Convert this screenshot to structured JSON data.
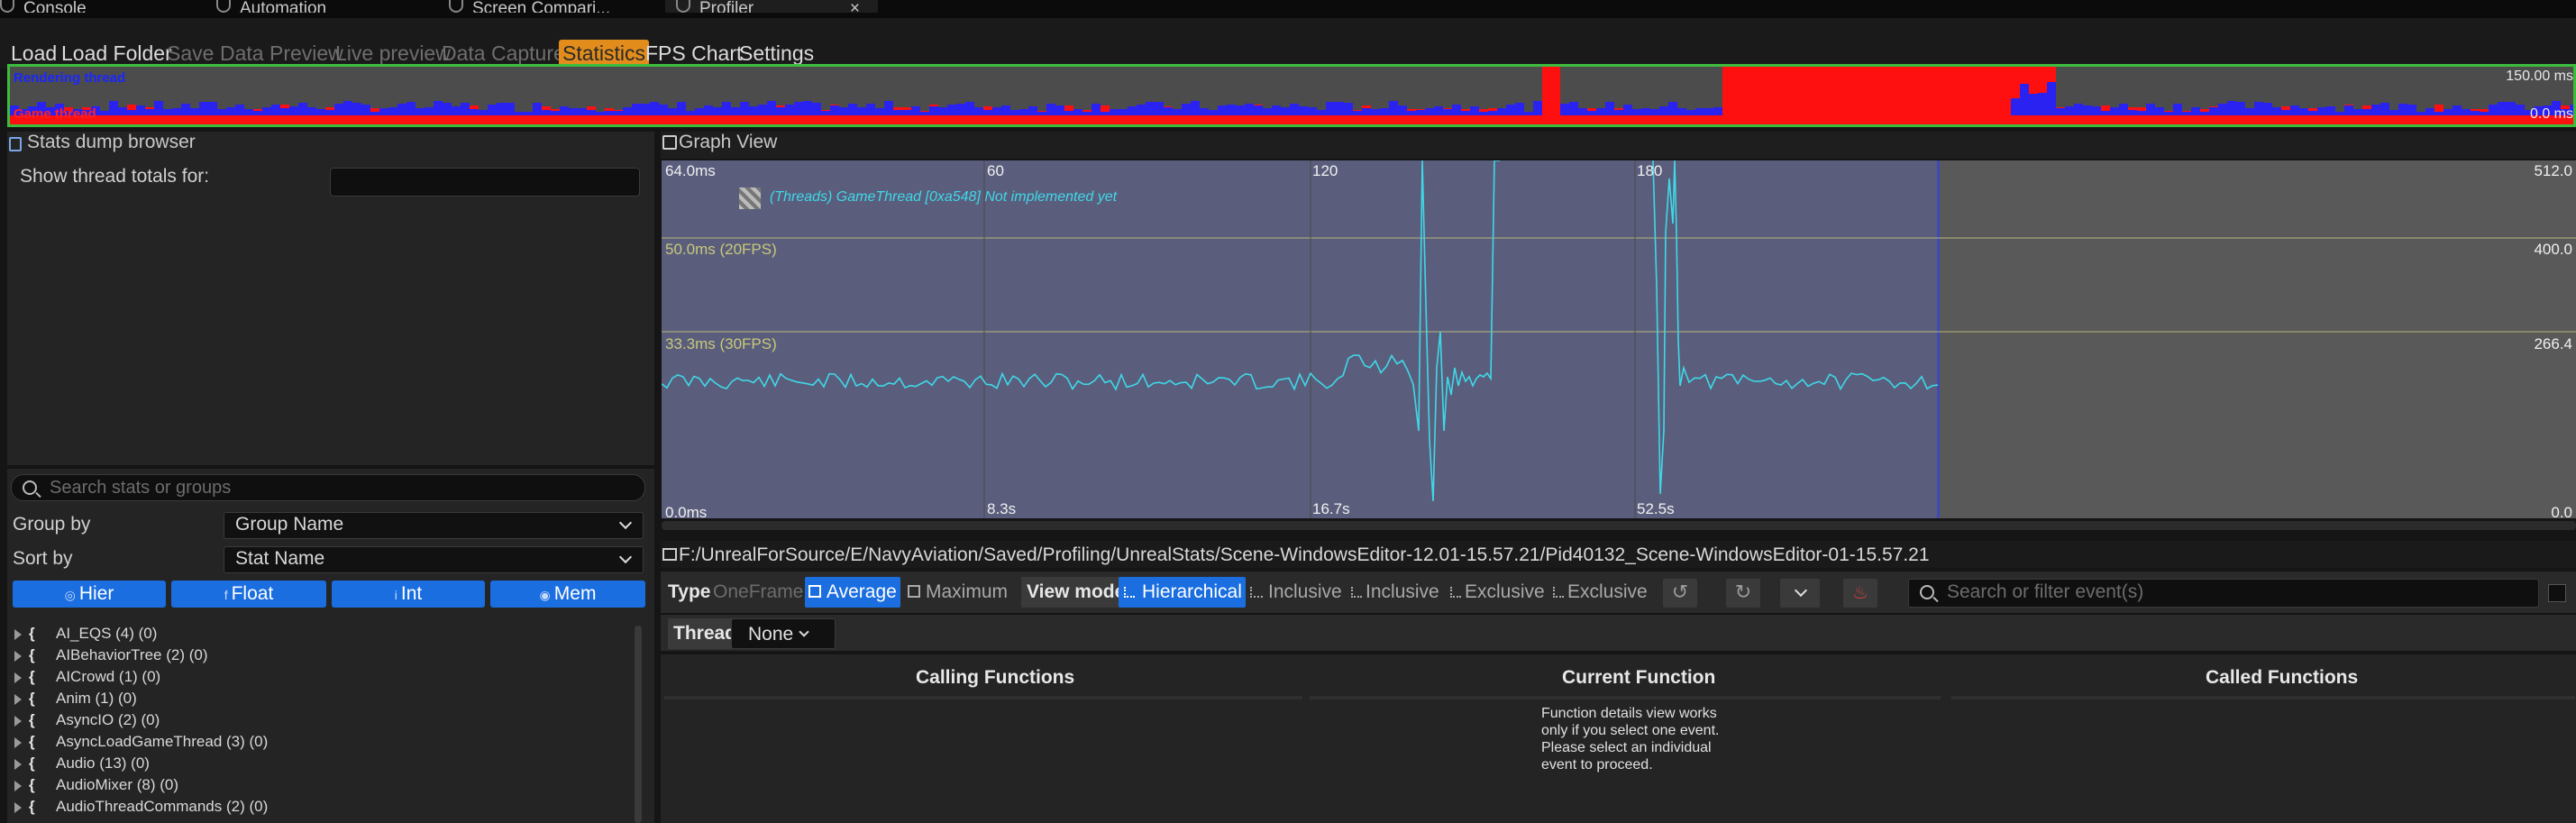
{
  "tabs": [
    {
      "label": "Console"
    },
    {
      "label": "Automation"
    },
    {
      "label": "Screen Compari..."
    },
    {
      "label": "Profiler",
      "close": "×"
    }
  ],
  "toolbar": {
    "load": "Load",
    "load_folder": "Load Folder",
    "save": "Save",
    "data_preview": "Data Preview",
    "live_preview": "Live preview",
    "data_capture": "Data Capture",
    "statistics": "Statistics",
    "fps_chart": "FPS Chart",
    "settings": "Settings",
    "accent": "#e28c1c"
  },
  "minimap": {
    "rendering_label": "Rendering thread",
    "game_label": "Game thread",
    "max_label": "150.00 ms",
    "min_label": "0.0 ms",
    "rendering_color": "#2a22f0",
    "game_color": "#ff1010"
  },
  "stats_browser": {
    "title": "Stats dump browser",
    "show_thread_totals": "Show thread totals for:",
    "search_placeholder": "Search stats or groups",
    "group_by_label": "Group by",
    "group_by_value": "Group Name",
    "sort_by_label": "Sort by",
    "sort_by_value": "Stat Name",
    "buttons": [
      "Hier",
      "Float",
      "Int",
      "Mem"
    ],
    "groups": [
      "AI_EQS (4) (0)",
      "AIBehaviorTree (2) (0)",
      "AICrowd (1) (0)",
      "Anim (1) (0)",
      "AsyncIO (2) (0)",
      "AsyncLoadGameThread (3) (0)",
      "Audio (13) (0)",
      "AudioMixer (8) (0)",
      "AudioThreadCommands (2) (0)"
    ]
  },
  "graph": {
    "title": "Graph View",
    "left_top": "64.0ms",
    "left_bottom": "0.0ms",
    "ref_20fps": "50.0ms (20FPS)",
    "ref_30fps": "33.3ms (30FPS)",
    "right_top": "512.0",
    "right_mid1": "400.0",
    "right_mid2": "266.4",
    "right_bottom": "0.0",
    "frame_ticks": [
      "60",
      "120",
      "180"
    ],
    "time_ticks": [
      "8.3s",
      "16.7s",
      "52.5s"
    ],
    "legend": "(Threads) GameThread [0xa548] Not implemented yet",
    "line_color": "#3fd8e8"
  },
  "profile": {
    "path": "F:/UnrealForSource/E/NavyAviation/Saved/Profiling/UnrealStats/Scene-WindowsEditor-12.01-15.57.21/Pid40132_Scene-WindowsEditor-01-15.57.21",
    "type_label": "Type",
    "type_one_frame": "OneFrame",
    "type_average": "Average",
    "type_maximum": "Maximum",
    "view_mode_label": "View mode",
    "view_hierarchical": "Hierarchical",
    "view_inclusive1": "Inclusive",
    "view_inclusive2": "Inclusive",
    "view_exclusive1": "Exclusive",
    "view_exclusive2": "Exclusive",
    "search_placeholder": "Search or filter event(s)",
    "thread_label": "Thread",
    "thread_value": "None",
    "calling_functions": "Calling Functions",
    "current_function": "Current Function",
    "called_functions": "Called Functions",
    "function_details_msg": "Function details view works only if you select one event. Please select an individual event to proceed."
  }
}
